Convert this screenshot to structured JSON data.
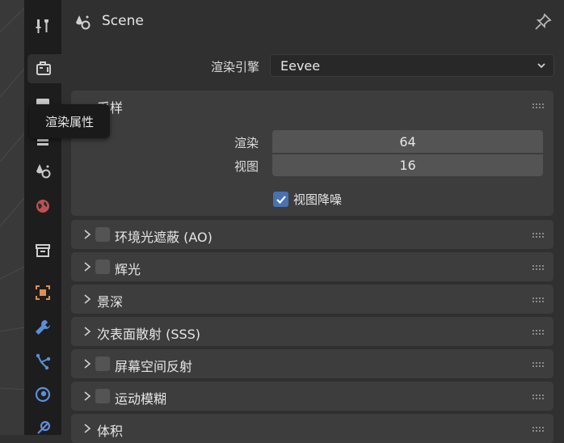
{
  "header": {
    "scene_title": "Scene",
    "scene_icon": "scene-icon",
    "pin_icon": "pin-icon"
  },
  "tabs": [
    {
      "name": "tool",
      "icon": "tool-icon"
    },
    {
      "name": "render",
      "icon": "render-camera-icon",
      "active": true
    },
    {
      "name": "output",
      "icon": "output-printer-icon"
    },
    {
      "name": "view-layer",
      "icon": "view-layer-icon"
    },
    {
      "name": "scene",
      "icon": "scene-icon"
    },
    {
      "name": "world",
      "icon": "world-icon"
    },
    {
      "name": "collection",
      "icon": "collection-icon"
    },
    {
      "name": "object",
      "icon": "object-icon"
    },
    {
      "name": "modifiers",
      "icon": "wrench-icon"
    },
    {
      "name": "particles",
      "icon": "particles-icon"
    },
    {
      "name": "physics",
      "icon": "physics-icon"
    },
    {
      "name": "constraints",
      "icon": "constraint-icon"
    }
  ],
  "tooltip": "渲染属性",
  "render_engine": {
    "label": "渲染引擎",
    "value": "Eevee"
  },
  "sampling": {
    "title": "采样",
    "render_label": "渲染",
    "render_value": "64",
    "viewport_label": "视图",
    "viewport_value": "16",
    "denoise_label": "视图降噪",
    "denoise_checked": true
  },
  "sections": [
    {
      "title": "环境光遮蔽 (AO)",
      "has_checkbox": true
    },
    {
      "title": "辉光",
      "has_checkbox": true
    },
    {
      "title": "景深",
      "has_checkbox": false
    },
    {
      "title": "次表面散射 (SSS)",
      "has_checkbox": false
    },
    {
      "title": "屏幕空间反射",
      "has_checkbox": true
    },
    {
      "title": "运动模糊",
      "has_checkbox": true
    },
    {
      "title": "体积",
      "has_checkbox": false
    }
  ],
  "colors": {
    "panel_bg": "#303030",
    "section_bg": "#3d3d3d",
    "field_bg": "#545454",
    "accent": "#4772b3"
  }
}
